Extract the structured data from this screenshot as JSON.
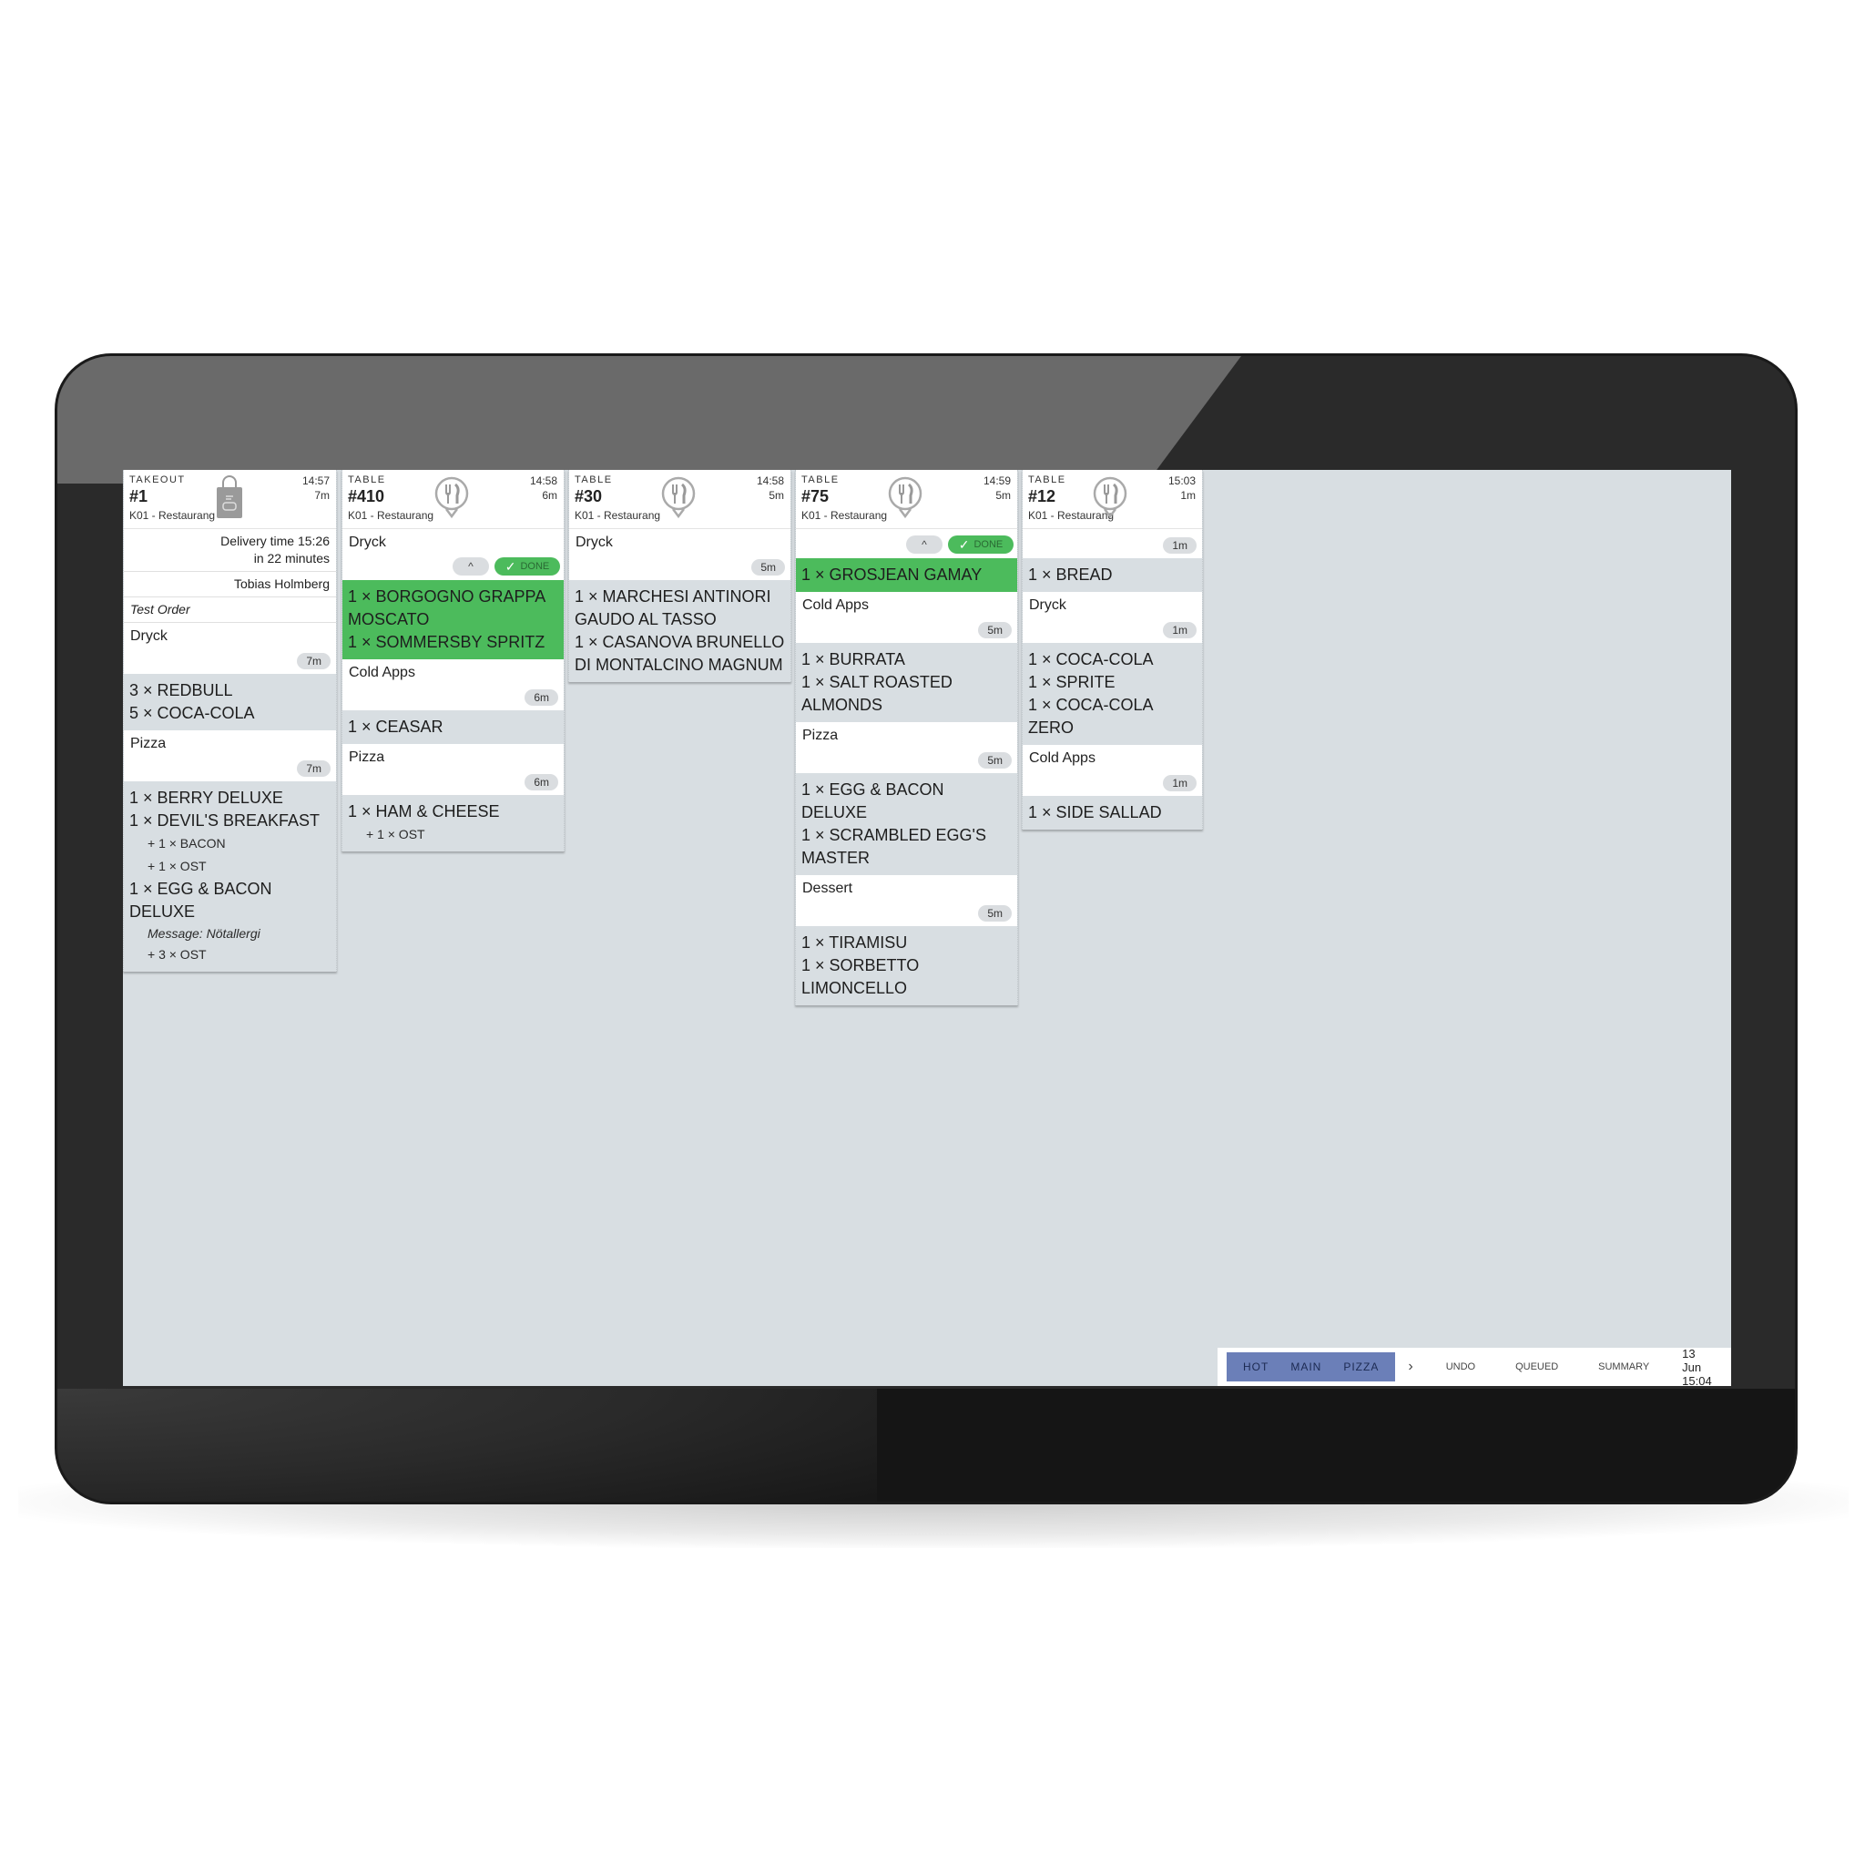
{
  "orders": [
    {
      "type": "TAKEOUT",
      "number": "#1",
      "location": "K01 - Restaurang",
      "time": "14:57",
      "age": "7m",
      "icon": "takeout-bag-icon",
      "info": {
        "delivery_line1": "Delivery time 15:26",
        "delivery_line2": "in 22 minutes",
        "customer": "Tobias Holmberg",
        "note": "Test Order"
      },
      "sections": [
        {
          "title": "Dryck",
          "age": "7m",
          "items": [
            "3 × REDBULL",
            "5 × COCA-COLA"
          ]
        },
        {
          "title": "Pizza",
          "age": "7m",
          "items": [
            "1 × BERRY DELUXE",
            "1 × DEVIL'S BREAKFAST"
          ],
          "modifiers": [
            "+ 1 × BACON",
            "+ 1 × OST"
          ],
          "extra_item": "1 × EGG & BACON DELUXE",
          "message": "Message: Nötallergi",
          "extra_modifier": "+ 3 × OST"
        }
      ]
    },
    {
      "type": "TABLE",
      "number": "#410",
      "location": "K01 - Restaurang",
      "time": "14:58",
      "age": "6m",
      "icon": "dining-fork-knife-icon",
      "sections": [
        {
          "title": "Dryck",
          "done_label": "DONE",
          "up_label": "^",
          "status": "done",
          "items": [
            "1 × BORGOGNO GRAPPA MOSCATO",
            "1 × SOMMERSBY SPRITZ"
          ]
        },
        {
          "title": "Cold Apps",
          "age": "6m",
          "items": [
            "1 × CEASAR"
          ]
        },
        {
          "title": "Pizza",
          "age": "6m",
          "items": [
            "1 × HAM & CHEESE"
          ],
          "modifiers": [
            "+ 1 × OST"
          ]
        }
      ]
    },
    {
      "type": "TABLE",
      "number": "#30",
      "location": "K01 - Restaurang",
      "time": "14:58",
      "age": "5m",
      "icon": "dining-fork-knife-icon",
      "sections": [
        {
          "title": "Dryck",
          "age": "5m",
          "items": [
            "1 × MARCHESI ANTINORI GAUDO AL TASSO",
            "1 × CASANOVA BRUNELLO DI MONTALCINO MAGNUM"
          ]
        }
      ]
    },
    {
      "type": "TABLE",
      "number": "#75",
      "location": "K01 - Restaurang",
      "time": "14:59",
      "age": "5m",
      "icon": "dining-fork-knife-icon",
      "sections": [
        {
          "title": "",
          "done_label": "DONE",
          "up_label": "^",
          "status": "done",
          "items": [
            "1 × GROSJEAN GAMAY"
          ]
        },
        {
          "title": "Cold Apps",
          "age": "5m",
          "items": [
            "1 × BURRATA",
            "1 × SALT ROASTED ALMONDS"
          ]
        },
        {
          "title": "Pizza",
          "age": "5m",
          "items": [
            "1 × EGG & BACON DELUXE",
            "1 × SCRAMBLED EGG'S MASTER"
          ]
        },
        {
          "title": "Dessert",
          "age": "5m",
          "items": [
            "1 × TIRAMISU",
            "1 × SORBETTO LIMONCELLO"
          ]
        }
      ]
    },
    {
      "type": "TABLE",
      "number": "#12",
      "location": "K01 - Restaurang",
      "time": "15:03",
      "age": "1m",
      "icon": "dining-fork-knife-icon",
      "sections": [
        {
          "title": "",
          "age": "1m",
          "items": [
            "1 × BREAD"
          ]
        },
        {
          "title": "Dryck",
          "age": "1m",
          "items": [
            "1 × COCA-COLA",
            "1 × SPRITE",
            "1 × COCA-COLA ZERO"
          ]
        },
        {
          "title": "Cold Apps",
          "age": "1m",
          "items": [
            "1 × SIDE SALLAD"
          ]
        }
      ]
    }
  ],
  "toolbar": {
    "filters": [
      "HOT",
      "MAIN",
      "PIZZA"
    ],
    "next_label": "›",
    "undo_label": "UNDO",
    "queued_label": "QUEUED",
    "summary_label": "SUMMARY",
    "datetime": "13 Jun 15:04",
    "more_label": "⋮"
  },
  "colors": {
    "done_green": "#4cbb5c",
    "filter_active": "#6b7fb8",
    "screen_bg": "#d8dee2"
  }
}
